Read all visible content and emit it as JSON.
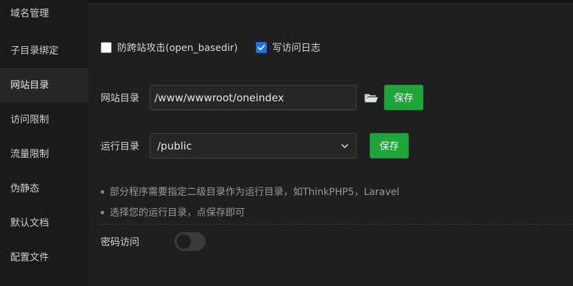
{
  "sidebar": {
    "items": [
      {
        "label": "域名管理"
      },
      {
        "label": "子目录绑定"
      },
      {
        "label": "网站目录",
        "active": true
      },
      {
        "label": "访问限制"
      },
      {
        "label": "流量限制"
      },
      {
        "label": "伪静态"
      },
      {
        "label": "默认文档"
      },
      {
        "label": "配置文件"
      }
    ]
  },
  "options": {
    "open_basedir": {
      "label": "防跨站攻击(open_basedir)",
      "checked": false
    },
    "access_log": {
      "label": "写访问日志",
      "checked": true
    }
  },
  "site_dir": {
    "label": "网站目录",
    "value": "/www/wwwroot/oneindex",
    "save_label": "保存",
    "folder_icon": "folder-open-icon"
  },
  "run_dir": {
    "label": "运行目录",
    "value": "/public",
    "save_label": "保存"
  },
  "tips": [
    "部分程序需要指定二级目录作为运行目录，如ThinkPHP5，Laravel",
    "选择您的运行目录，点保存即可"
  ],
  "password_access": {
    "label": "密码访问",
    "enabled": false
  },
  "colors": {
    "accent_green": "#20a53a",
    "checkbox_blue": "#1a73e8",
    "background": "#1f1f1f"
  }
}
